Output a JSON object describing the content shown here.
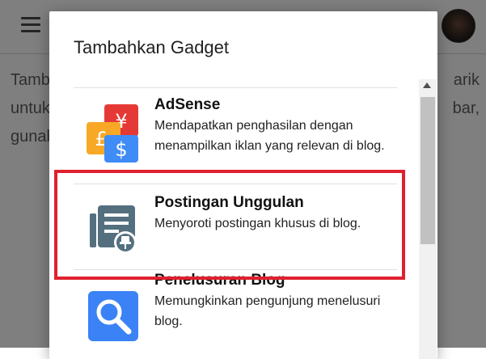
{
  "background": {
    "text_lines": [
      {
        "left": "Tamb",
        "right": "arik"
      },
      {
        "left": "untuk",
        "right": "bar,"
      },
      {
        "left": "gunal",
        "right": ""
      }
    ]
  },
  "dialog": {
    "title": "Tambahkan Gadget",
    "items": [
      {
        "title": "AdSense",
        "description": "Mendapatkan penghasilan dengan menampilkan iklan yang relevan di blog.",
        "icon": "adsense-icon"
      },
      {
        "title": "Postingan Unggulan",
        "description": "Menyoroti postingan khusus di blog.",
        "icon": "featured-post-icon"
      },
      {
        "title": "Penelusuran Blog",
        "description": "Memungkinkan pengunjung menelusuri blog.",
        "icon": "blog-search-icon"
      }
    ]
  },
  "colors": {
    "highlight": "#e0202e",
    "adsense_red": "#e53935",
    "adsense_yellow": "#f9a825",
    "adsense_blue": "#3f8cf7",
    "featured_icon": "#54707f",
    "search_blue": "#3b82f6"
  }
}
